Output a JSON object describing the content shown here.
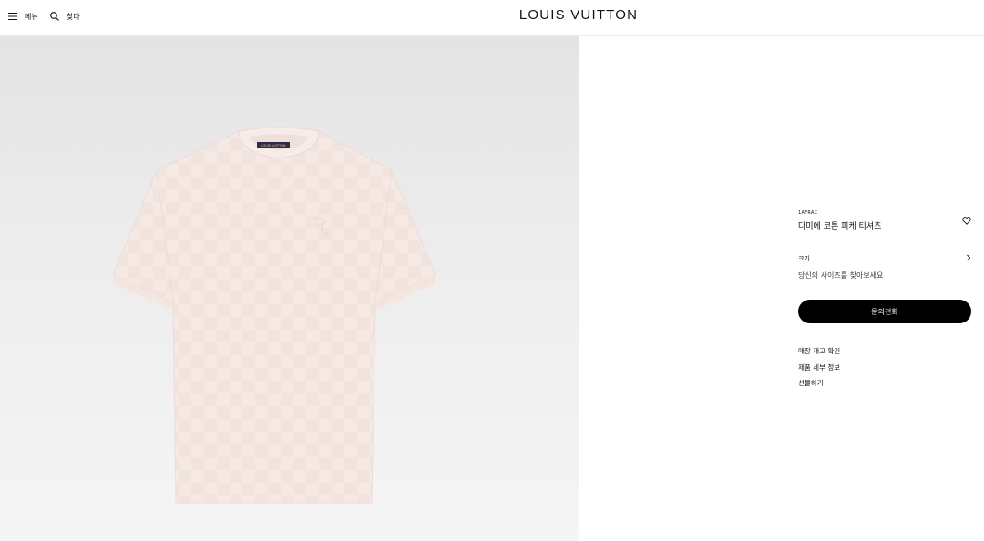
{
  "header": {
    "menu_label": "메뉴",
    "search_label": "찾다",
    "brand": "LOUIS VUITTON"
  },
  "product": {
    "sku": "1AFRAC",
    "title": "다미에 코튼 피케 티셔츠",
    "size_label": "크기",
    "size_finder": "당신의 사이즈를 찾아보세요",
    "cta_label": "문의전화",
    "links": [
      "매장 재고 확인",
      "제품 세부 정보",
      "선물하기"
    ],
    "label_tag_text": "LOUIS VUITTON"
  },
  "colors": {
    "shirt": "#f6e9e4",
    "accent": "#000000"
  }
}
